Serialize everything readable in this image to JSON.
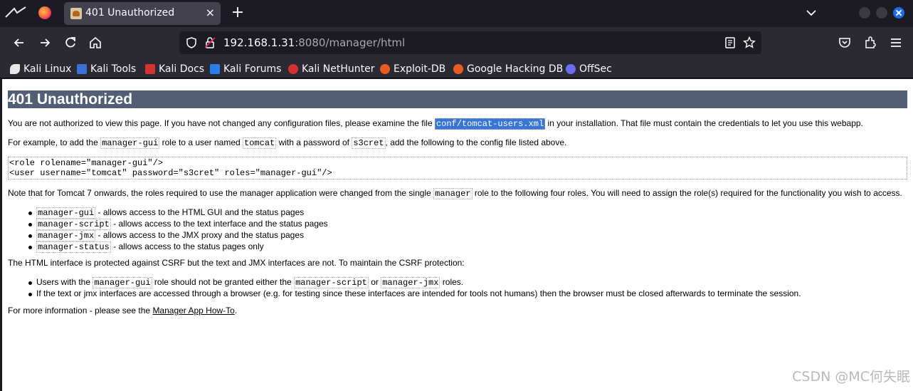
{
  "tab": {
    "title": "401 Unauthorized",
    "close": "×",
    "new_tab": "+"
  },
  "url": {
    "host": "192.168.1.31",
    "rest": ":8080/manager/html"
  },
  "bookmarks": [
    {
      "label": "Kali Linux",
      "icon": "kali-dragon-icon",
      "color": "#ffffff"
    },
    {
      "label": "Kali Tools",
      "icon": "kali-tools-icon",
      "color": "#3d6fd6"
    },
    {
      "label": "Kali Docs",
      "icon": "kali-docs-icon",
      "color": "#d43131"
    },
    {
      "label": "Kali Forums",
      "icon": "kali-forums-icon",
      "color": "#2b7de9"
    },
    {
      "label": "Kali NetHunter",
      "icon": "nethunter-icon",
      "color": "#d43131"
    },
    {
      "label": "Exploit-DB",
      "icon": "exploit-db-icon",
      "color": "#e85d1f"
    },
    {
      "label": "Google Hacking DB",
      "icon": "ghdb-icon",
      "color": "#e85d1f"
    },
    {
      "label": "OffSec",
      "icon": "offsec-icon",
      "color": "#6c6cf0"
    }
  ],
  "page": {
    "heading": "401 Unauthorized",
    "p1_a": "You are not authorized to view this page. If you have not changed any configuration files, please examine the file ",
    "p1_code": "conf/tomcat-users.xml",
    "p1_b": " in your installation. That file must contain the credentials to let you use this webapp.",
    "p2_a": "For example, to add the ",
    "p2_c1": "manager-gui",
    "p2_b": " role to a user named ",
    "p2_c2": "tomcat",
    "p2_c": " with a password of ",
    "p2_c3": "s3cret",
    "p2_d": ", add the following to the config file listed above.",
    "pre_line1": "<role rolename=\"manager-gui\"/>",
    "pre_line2": "<user username=\"tomcat\" password=\"s3cret\" roles=\"manager-gui\"/>",
    "p3_a": "Note that for Tomcat 7 onwards, the roles required to use the manager application were changed from the single ",
    "p3_code": "manager",
    "p3_b": " role to the following four roles. You will need to assign the role(s) required for the functionality you wish to access.",
    "roles": [
      {
        "code": "manager-gui",
        "text": " - allows access to the HTML GUI and the status pages"
      },
      {
        "code": "manager-script",
        "text": " - allows access to the text interface and the status pages"
      },
      {
        "code": "manager-jmx",
        "text": " - allows access to the JMX proxy and the status pages"
      },
      {
        "code": "manager-status",
        "text": " - allows access to the status pages only"
      }
    ],
    "p4": "The HTML interface is protected against CSRF but the text and JMX interfaces are not. To maintain the CSRF protection:",
    "csrf1_a": "Users with the ",
    "csrf1_c1": "manager-gui",
    "csrf1_b": " role should not be granted either the ",
    "csrf1_c2": "manager-script",
    "csrf1_c": " or ",
    "csrf1_c3": "manager-jmx",
    "csrf1_d": " roles.",
    "csrf2": "If the text or jmx interfaces are accessed through a browser (e.g. for testing since these interfaces are intended for tools not humans) then the browser must be closed afterwards to terminate the session.",
    "p5_a": "For more information - please see the ",
    "p5_link": "Manager App How-To",
    "p5_b": "."
  },
  "watermark": "CSDN @MC何失眠"
}
